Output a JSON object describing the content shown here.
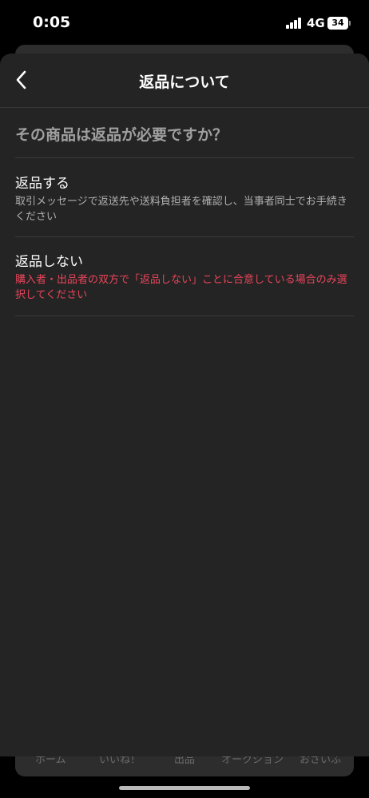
{
  "status_bar": {
    "time": "0:05",
    "network": "4G",
    "battery": "34"
  },
  "nav": {
    "title": "返品について"
  },
  "question": "その商品は返品が必要ですか？",
  "options": [
    {
      "title": "返品する",
      "description": "取引メッセージで返送先や送料負担者を確認し、当事者同士でお手続きください"
    },
    {
      "title": "返品しない",
      "description": "購入者・出品者の双方で「返品しない」ことに合意している場合のみ選択してください"
    }
  ],
  "background_tabs": [
    "ホーム",
    "いいね！",
    "出品",
    "オークション",
    "おさいふ"
  ],
  "colors": {
    "sheet": "#242424",
    "warning": "#e8455a",
    "question": "#a0a0a0"
  }
}
